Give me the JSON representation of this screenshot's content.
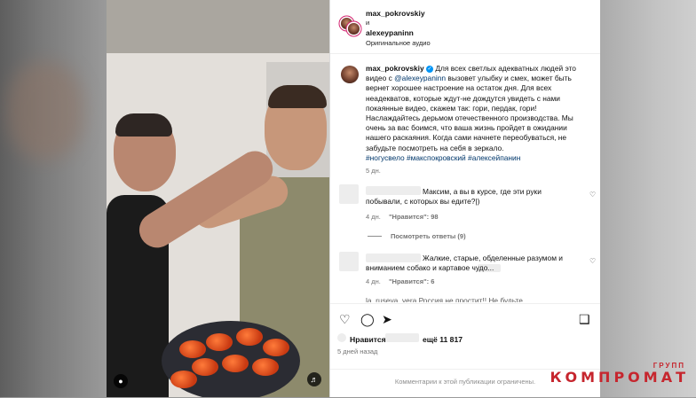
{
  "header": {
    "user1": "max_pokrovskiy",
    "conjunction": "и",
    "user2": "alexeypaninn",
    "audio": "Оригинальное аудио"
  },
  "post": {
    "author": "max_pokrovskiy",
    "caption_before_mention": "Для всех светлых адекватных людей это видео с ",
    "mention": "@alexeypaninn",
    "caption_after_mention": " вызовет улыбку и смех, может быть вернет хорошее настроение на остаток дня. Для всех неадекватов, которые ждут-не дождутся увидеть с нами покаянные видео, скажем так: гори, пердак, гори! Наслаждайтесь дерьмом отечественного производства. Мы очень за вас боимся, что ваша жизнь пройдет в ожидании нашего раскаяния. Когда сами начнете переобуваться, не забудьте посмотреть на себя в зеркало.",
    "hashtags": "#ногусвело #макспокровский #алексейпанин",
    "age": "5 дн."
  },
  "comments": [
    {
      "text": "Максим, а вы в курсе, где эти руки побывали, с которых вы едите?|)",
      "age": "4 дн.",
      "likes": "\"Нравится\": 98",
      "replies": "Посмотреть ответы (9)"
    },
    {
      "text": "Жалкие, старые, обделенные разумом и вниманием собако      и картавое чудо...",
      "age": "4 дн.",
      "likes": "\"Нравится\": 6"
    }
  ],
  "truncated_comment": "la_ruseva_vera Россия не простит!! Не будьте...",
  "likes_text": "Нравится",
  "likes_more": "ещё 11 817",
  "date": "5 дней назад",
  "comments_limited": "Комментарии к этой публикации ограничены.",
  "watermark": {
    "small": "ГРУПП",
    "big": "КОМПРОМАТ"
  },
  "colors": {
    "link": "#00376b",
    "verified": "#0095f6",
    "watermark": "#c6262e"
  }
}
